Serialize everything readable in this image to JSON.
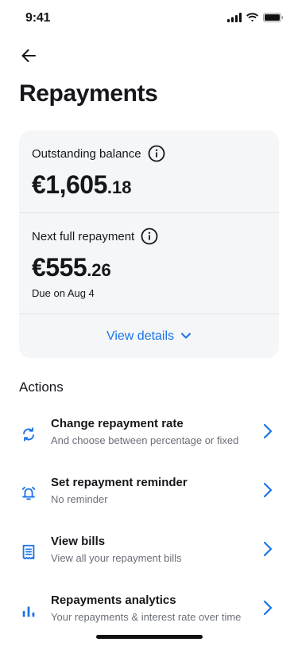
{
  "status_bar": {
    "time": "9:41"
  },
  "header": {
    "title": "Repayments"
  },
  "balance_card": {
    "outstanding_label": "Outstanding balance",
    "outstanding_whole": "€1,605",
    "outstanding_cents": ".18",
    "next_label": "Next full repayment",
    "next_whole": "€555",
    "next_cents": ".26",
    "due_text": "Due on Aug 4",
    "view_details_label": "View details"
  },
  "actions": {
    "title": "Actions",
    "items": [
      {
        "title": "Change repayment rate",
        "subtitle": "And choose between percentage or fixed",
        "icon": "refresh-icon"
      },
      {
        "title": "Set repayment reminder",
        "subtitle": "No reminder",
        "icon": "alarm-icon"
      },
      {
        "title": "View bills",
        "subtitle": "View all your repayment bills",
        "icon": "bill-icon"
      },
      {
        "title": "Repayments analytics",
        "subtitle": "Your repayments & interest rate over time",
        "icon": "bar-chart-icon"
      }
    ]
  },
  "colors": {
    "accent": "#1a73e8",
    "card_bg": "#f5f6f8",
    "text": "#16171b",
    "muted": "#6b6f78"
  }
}
